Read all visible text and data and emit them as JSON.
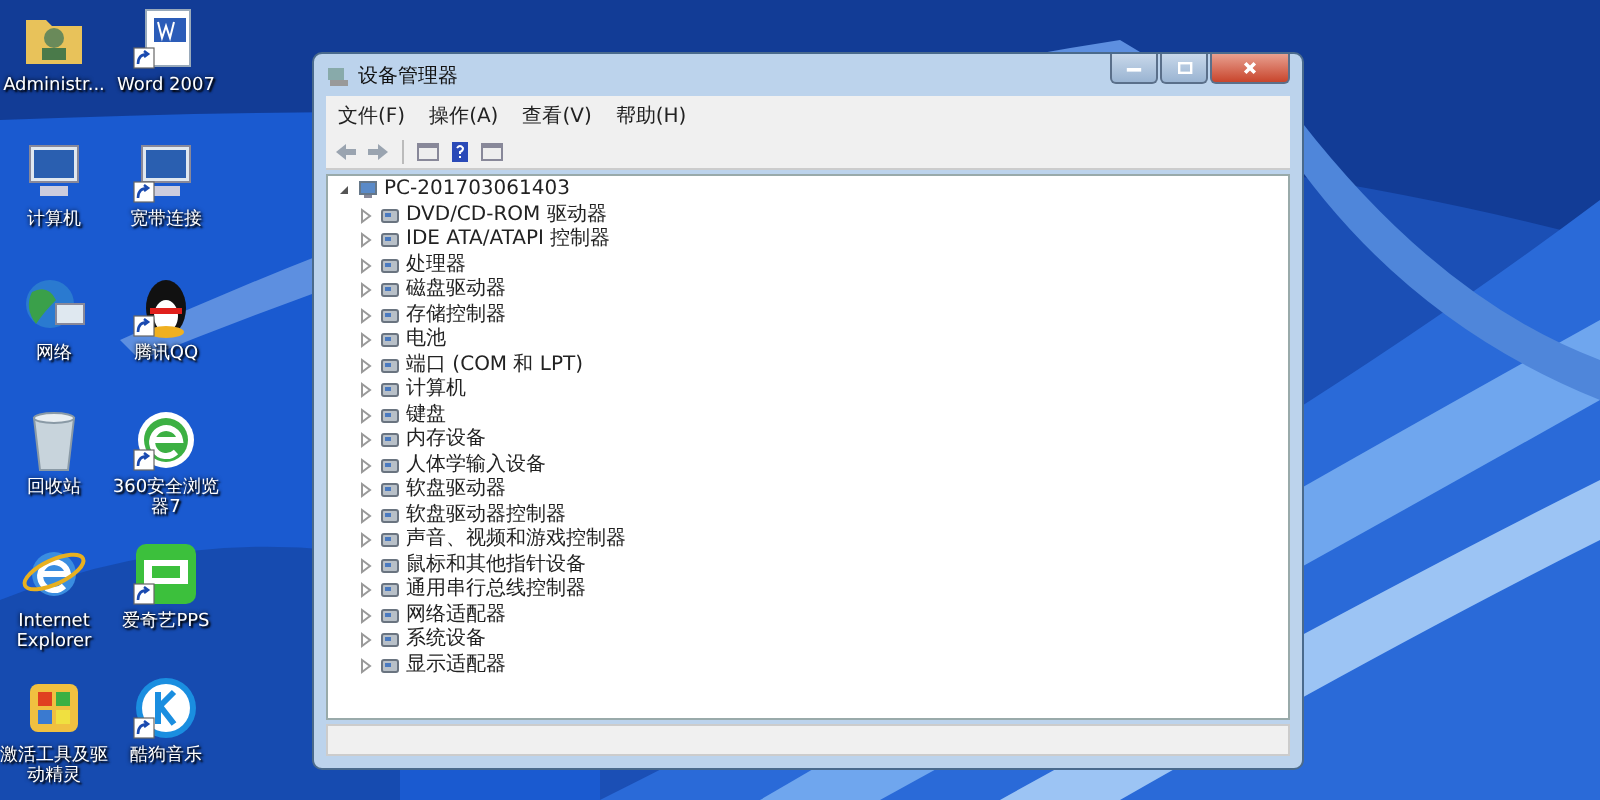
{
  "desktop_icons": [
    {
      "label": "Administr...",
      "kind": "folder",
      "shortcut": false
    },
    {
      "label": "Word 2007",
      "kind": "document",
      "shortcut": true
    },
    {
      "label": "计算机",
      "kind": "computer",
      "shortcut": false
    },
    {
      "label": "宽带连接",
      "kind": "network",
      "shortcut": true
    },
    {
      "label": "网络",
      "kind": "globe",
      "shortcut": false
    },
    {
      "label": "腾讯QQ",
      "kind": "penguin",
      "shortcut": true
    },
    {
      "label": "回收站",
      "kind": "trash",
      "shortcut": false
    },
    {
      "label": "360安全浏览器7",
      "kind": "browser",
      "shortcut": true
    },
    {
      "label": "Internet Explorer",
      "kind": "ie",
      "shortcut": false
    },
    {
      "label": "爱奇艺PPS",
      "kind": "tv",
      "shortcut": true
    },
    {
      "label": "激活工具及驱动精灵",
      "kind": "tool",
      "shortcut": false
    },
    {
      "label": "酷狗音乐",
      "kind": "music",
      "shortcut": true
    }
  ],
  "window": {
    "title": "设备管理器"
  },
  "menu": [
    "文件(F)",
    "操作(A)",
    "查看(V)",
    "帮助(H)"
  ],
  "tree": {
    "label": "PC-201703061403",
    "expanded": true,
    "children": [
      {
        "label": "DVD/CD-ROM 驱动器",
        "expanded": false
      },
      {
        "label": "IDE ATA/ATAPI 控制器",
        "expanded": false
      },
      {
        "label": "处理器",
        "expanded": false
      },
      {
        "label": "磁盘驱动器",
        "expanded": false
      },
      {
        "label": "存储控制器",
        "expanded": false
      },
      {
        "label": "电池",
        "expanded": false
      },
      {
        "label": "端口 (COM 和 LPT)",
        "expanded": false
      },
      {
        "label": "计算机",
        "expanded": false
      },
      {
        "label": "键盘",
        "expanded": false
      },
      {
        "label": "内存设备",
        "expanded": false
      },
      {
        "label": "人体学输入设备",
        "expanded": false
      },
      {
        "label": "软盘驱动器",
        "expanded": false
      },
      {
        "label": "软盘驱动器控制器",
        "expanded": false
      },
      {
        "label": "声音、视频和游戏控制器",
        "expanded": false
      },
      {
        "label": "鼠标和其他指针设备",
        "expanded": false
      },
      {
        "label": "通用串行总线控制器",
        "expanded": false
      },
      {
        "label": "网络适配器",
        "expanded": false
      },
      {
        "label": "系统设备",
        "expanded": false
      },
      {
        "label": "显示适配器",
        "expanded": false
      }
    ]
  }
}
